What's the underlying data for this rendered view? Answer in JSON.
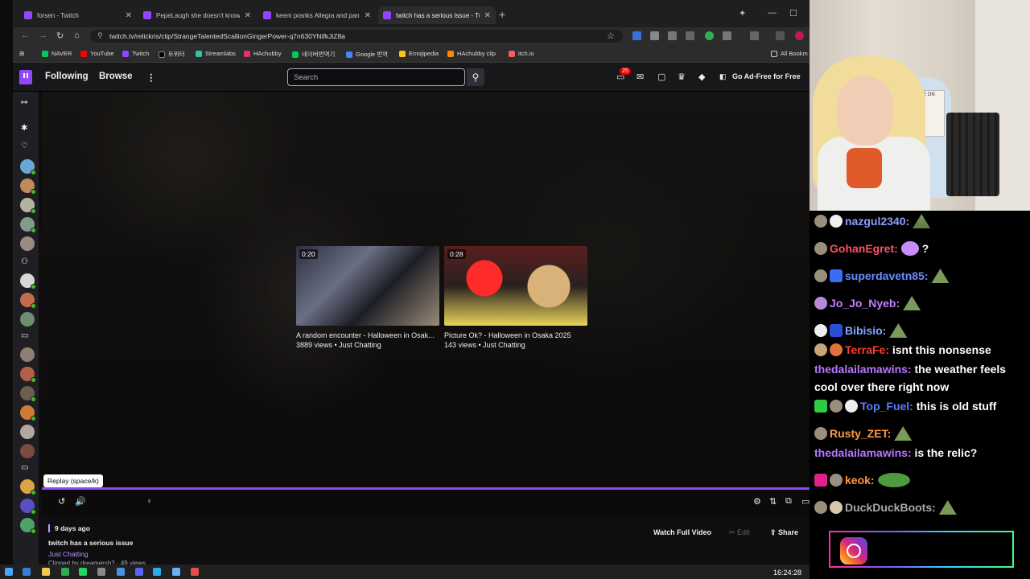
{
  "browser": {
    "tabs": [
      {
        "label": "forsen - Twitch",
        "active": false
      },
      {
        "label": "PepeLaugh she doesn't know -",
        "active": false
      },
      {
        "label": "keem pranks Allegra and pan",
        "active": false
      },
      {
        "label": "twitch has a serious issue - Twit",
        "active": true
      }
    ],
    "url": "twitch.tv/relickris/clip/StrangeTalentedScallionGingerPower-q7n630YNifkJiZ8a",
    "bookmarks": [
      "NAVER",
      "YouTube",
      "Twitch",
      "트위터",
      "Streamlabs",
      "HAchubby",
      "네이버번역기",
      "Google 번역",
      "Emojipedia",
      "HAchubby clip",
      "itch.io"
    ],
    "all_bookmarks": "All Bookm"
  },
  "twitch_nav": {
    "following": "Following",
    "browse": "Browse",
    "search_placeholder": "Search",
    "notif_count": "25",
    "ad_free": "Go Ad-Free for Free"
  },
  "player": {
    "replay_tooltip": "Replay (space/k)",
    "recommendations": [
      {
        "duration": "0:20",
        "title": "A random encounter - Halloween in Osak...",
        "meta": "3889 views • Just Chatting"
      },
      {
        "duration": "0:28",
        "title": "Picture Ok? - Halloween in Osaka 2025",
        "meta": "143 views • Just Chatting"
      }
    ]
  },
  "clip": {
    "age": "9 days ago",
    "title": "twitch has a serious issue",
    "category": "Just Chatting",
    "clipped_by": "Clipped by dreamersh? · 49 views",
    "watch_full": "Watch Full Video",
    "edit": "Edit",
    "share": "Share"
  },
  "taskbar": {
    "clock": "16:24:28"
  },
  "webcam": {
    "sign": "LIVE ON"
  },
  "chat": {
    "messages": [
      {
        "user": "nazgul2340:",
        "color": "#8aa0ff",
        "text": ""
      },
      {
        "user": "GohanEgret:",
        "color": "#ff4f6b",
        "text": "?"
      },
      {
        "user": "superdavetn85:",
        "color": "#6b8cff",
        "text": ""
      },
      {
        "user": "Jo_Jo_Nyeb:",
        "color": "#c77dff",
        "text": ""
      },
      {
        "user": "Bibisio:",
        "color": "#7fa6ff",
        "text": ""
      },
      {
        "user": "TerraFe:",
        "color": "#ff3b30",
        "text": "isnt this nonsense"
      },
      {
        "user": "thedalailamawins:",
        "color": "#b678ff",
        "text": "the weather feels cool over there right now"
      },
      {
        "user": "Top_Fuel:",
        "color": "#5c7cff",
        "text": "this is old stuff"
      },
      {
        "user": "Rusty_ZET:",
        "color": "#ff9a3c",
        "text": ""
      },
      {
        "user": "thedalailamawins:",
        "color": "#b678ff",
        "text": "is the relic?"
      },
      {
        "user": "keok:",
        "color": "#ff9a3c",
        "text": ""
      },
      {
        "user": "DuckDuckBoots:",
        "color": "#a8a8a8",
        "text": ""
      }
    ]
  },
  "colors": {
    "twitch_purple": "#9146ff",
    "accent_light": "#bf94ff"
  }
}
